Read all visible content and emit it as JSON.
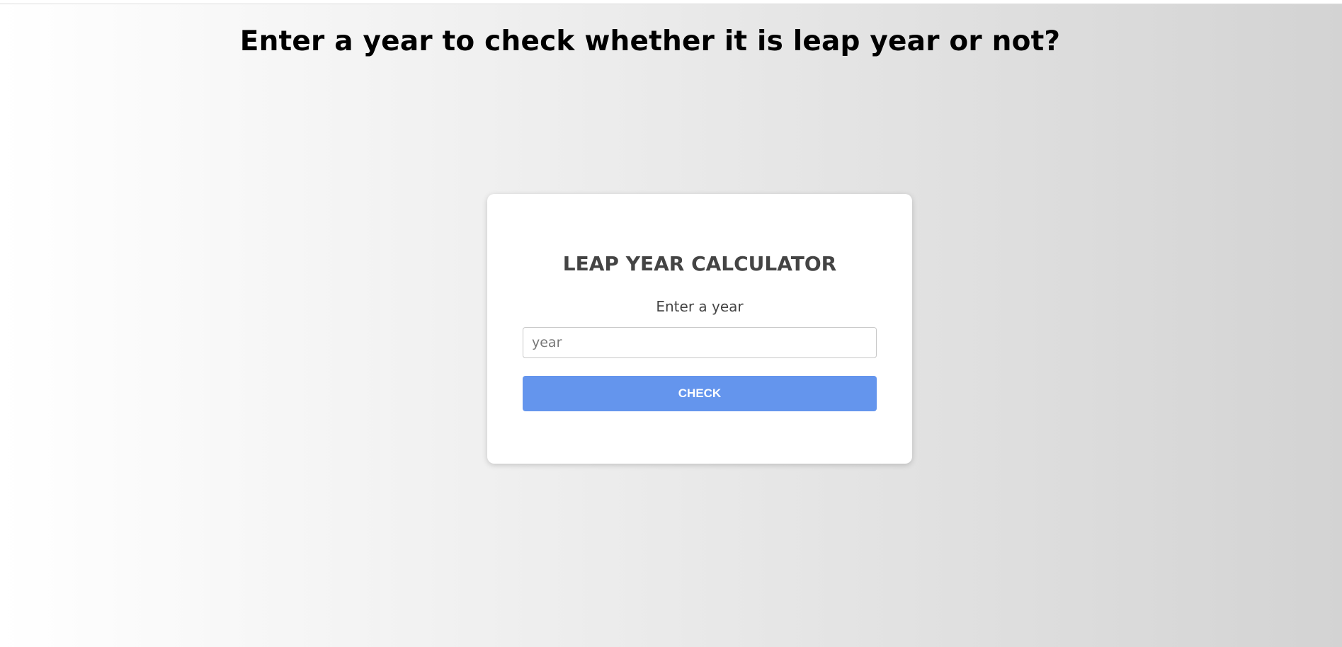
{
  "page": {
    "heading": "Enter a year to check whether it is leap year or not?"
  },
  "card": {
    "title": "LEAP YEAR CALCULATOR",
    "label": "Enter a year",
    "input": {
      "placeholder": "year",
      "value": ""
    },
    "button_label": "CHECK"
  },
  "colors": {
    "button": "#6495ed",
    "heading": "#000000",
    "card_text": "#444444"
  }
}
